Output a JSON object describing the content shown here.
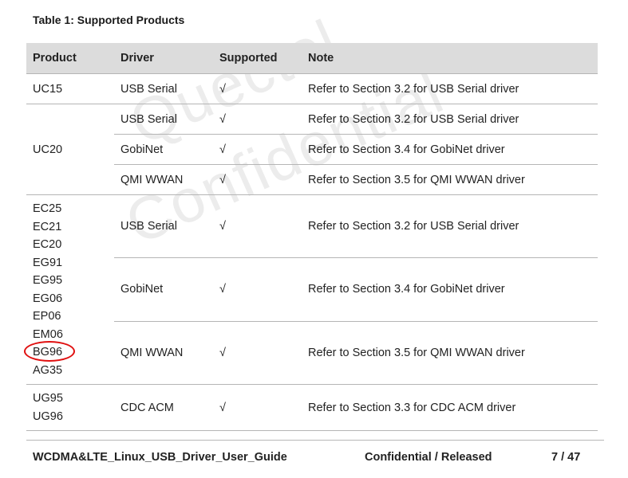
{
  "watermark": [
    "Quectel",
    "Confidential"
  ],
  "caption": "Table 1: Supported Products",
  "table": {
    "headers": [
      "Product",
      "Driver",
      "Supported",
      "Note"
    ],
    "check_mark": "√",
    "groups": [
      {
        "products": [
          "UC15"
        ],
        "rows": [
          {
            "driver": "USB Serial",
            "note": "Refer to Section 3.2 for USB Serial driver"
          }
        ]
      },
      {
        "products": [
          "UC20"
        ],
        "rows": [
          {
            "driver": "USB Serial",
            "note": "Refer to Section 3.2 for USB Serial driver"
          },
          {
            "driver": "GobiNet",
            "note": "Refer to Section 3.4 for GobiNet driver"
          },
          {
            "driver": "QMI WWAN",
            "note": "Refer to Section 3.5 for QMI WWAN driver"
          }
        ]
      },
      {
        "products": [
          "EC25",
          "EC21",
          "EC20",
          "EG91",
          "EG95",
          "EG06",
          "EP06",
          "EM06",
          "BG96",
          "AG35"
        ],
        "highlighted_product": "BG96",
        "rows": [
          {
            "driver": "USB Serial",
            "note": "Refer to Section 3.2 for USB Serial driver"
          },
          {
            "driver": "GobiNet",
            "note": "Refer to Section 3.4 for GobiNet driver"
          },
          {
            "driver": "QMI WWAN",
            "note": "Refer to Section 3.5 for QMI WWAN driver"
          }
        ]
      },
      {
        "products": [
          "UG95",
          "UG96"
        ],
        "rows": [
          {
            "driver": "CDC ACM",
            "note": "Refer to Section 3.3 for CDC ACM driver"
          }
        ]
      }
    ]
  },
  "footer": {
    "document": "WCDMA&LTE_Linux_USB_Driver_User_Guide",
    "status": "Confidential / Released",
    "page": "7 / 47"
  },
  "colors": {
    "header_bg": "#dcdcdc",
    "highlight_circle": "#e01010"
  }
}
